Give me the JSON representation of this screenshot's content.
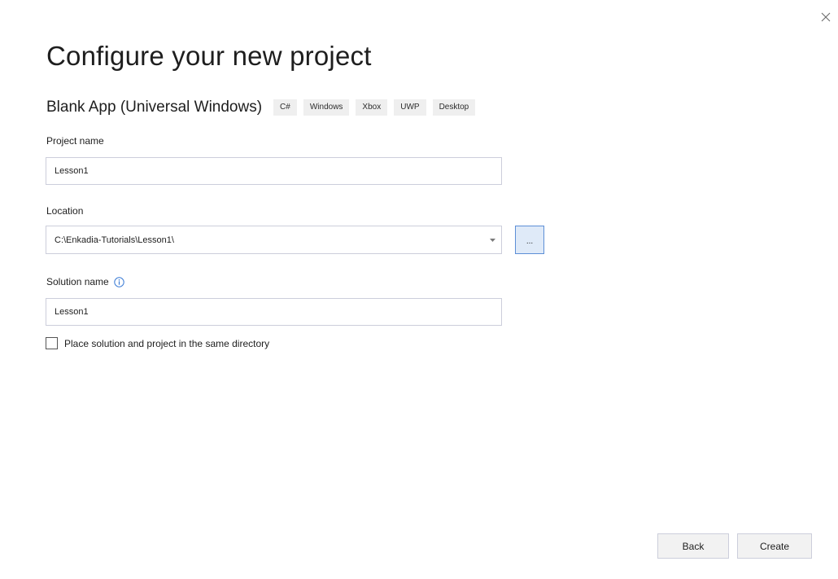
{
  "window": {
    "close_icon": "close-icon"
  },
  "header": {
    "title": "Configure your new project",
    "template_name": "Blank App (Universal Windows)",
    "tags": [
      "C#",
      "Windows",
      "Xbox",
      "UWP",
      "Desktop"
    ]
  },
  "form": {
    "project_name": {
      "label": "Project name",
      "value": "Lesson1"
    },
    "location": {
      "label": "Location",
      "value": "C:\\Enkadia-Tutorials\\Lesson1\\",
      "browse_label": "..."
    },
    "solution_name": {
      "label": "Solution name",
      "value": "Lesson1",
      "info_icon": "info-icon"
    },
    "same_directory": {
      "label": "Place solution and project in the same directory",
      "checked": false
    }
  },
  "footer": {
    "back_label": "Back",
    "create_label": "Create"
  },
  "colors": {
    "accent_border": "#5d8fd6",
    "accent_fill": "#dfeaf8",
    "info_icon": "#3a7bd5",
    "tag_background": "#efefef"
  }
}
